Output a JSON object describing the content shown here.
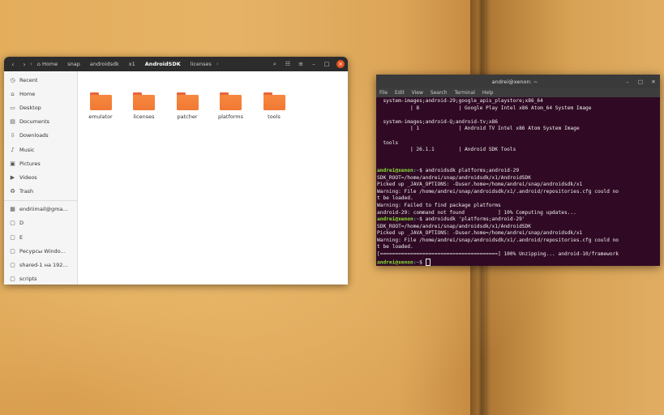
{
  "file_manager": {
    "breadcrumbs": [
      {
        "label": "Home",
        "icon": "home-icon"
      },
      {
        "label": "snap"
      },
      {
        "label": "androidsdk"
      },
      {
        "label": "x1"
      },
      {
        "label": "AndroidSDK",
        "active": true
      },
      {
        "label": "licenses"
      }
    ],
    "sidebar": [
      {
        "label": "Recent",
        "icon": "clock-icon"
      },
      {
        "label": "Home",
        "icon": "home-icon"
      },
      {
        "label": "Desktop",
        "icon": "desktop-icon"
      },
      {
        "label": "Documents",
        "icon": "document-icon"
      },
      {
        "label": "Downloads",
        "icon": "download-icon"
      },
      {
        "label": "Music",
        "icon": "music-icon"
      },
      {
        "label": "Pictures",
        "icon": "picture-icon"
      },
      {
        "label": "Videos",
        "icon": "video-icon"
      },
      {
        "label": "Trash",
        "icon": "trash-icon"
      },
      {
        "label": "endriimail@gma…",
        "icon": "drive-icon"
      },
      {
        "label": "D",
        "icon": "folder-icon"
      },
      {
        "label": "E",
        "icon": "folder-icon"
      },
      {
        "label": "Ресурсы Windo…",
        "icon": "folder-icon"
      },
      {
        "label": "shared-1 на 192…",
        "icon": "folder-icon"
      },
      {
        "label": "scripts",
        "icon": "folder-icon"
      }
    ],
    "folders": [
      "emulator",
      "licenses",
      "patcher",
      "platforms",
      "tools"
    ]
  },
  "terminal": {
    "title": "andrei@xenon: ~",
    "menu": [
      "File",
      "Edit",
      "View",
      "Search",
      "Terminal",
      "Help"
    ],
    "lines": [
      {
        "text": "  system-images;android-29;google_apis_playstore;x86_64"
      },
      {
        "text": "           | 8             | Google Play Intel x86 Atom_64 System Image"
      },
      {
        "text": ""
      },
      {
        "text": "  system-images;android-Q;android-tv;x86"
      },
      {
        "text": "           | 1             | Android TV Intel x86 Atom System Image"
      },
      {
        "text": ""
      },
      {
        "text": "  tools"
      },
      {
        "text": "           | 26.1.1        | Android SDK Tools"
      },
      {
        "text": ""
      },
      {
        "text": ""
      },
      {
        "user": "andrei@xenon",
        "path": ":~",
        "text": "$ androidsdk platforms;android-29"
      },
      {
        "text": "SDK_ROOT=/home/andrei/snap/androidsdk/x1/AndroidSDK"
      },
      {
        "text": "Picked up _JAVA_OPTIONS: -Duser.home=/home/andrei/snap/androidsdk/x1"
      },
      {
        "text": "Warning: File /home/andrei/snap/androidsdk/x1/.android/repositories.cfg could no"
      },
      {
        "text": "t be loaded."
      },
      {
        "text": "Warning: Failed to find package platforms"
      },
      {
        "text": "android-29: command not found           ] 10% Computing updates..."
      },
      {
        "user": "andrei@xenon",
        "path": ":~",
        "text": "$ androidsdk 'platforms;android-29'"
      },
      {
        "text": "SDK_ROOT=/home/andrei/snap/androidsdk/x1/AndroidSDK"
      },
      {
        "text": "Picked up _JAVA_OPTIONS: -Duser.home=/home/andrei/snap/androidsdk/x1"
      },
      {
        "text": "Warning: File /home/andrei/snap/androidsdk/x1/.android/repositories.cfg could no"
      },
      {
        "text": "t be loaded."
      },
      {
        "text": "[=======================================] 100% Unzipping... android-10/framework"
      },
      {
        "user": "andrei@xenon",
        "path": ":~",
        "text": "$ ",
        "cursor": true
      }
    ]
  },
  "colors": {
    "accent": "#e95420",
    "terminal_bg": "#300a24",
    "folder": "#f17834"
  }
}
